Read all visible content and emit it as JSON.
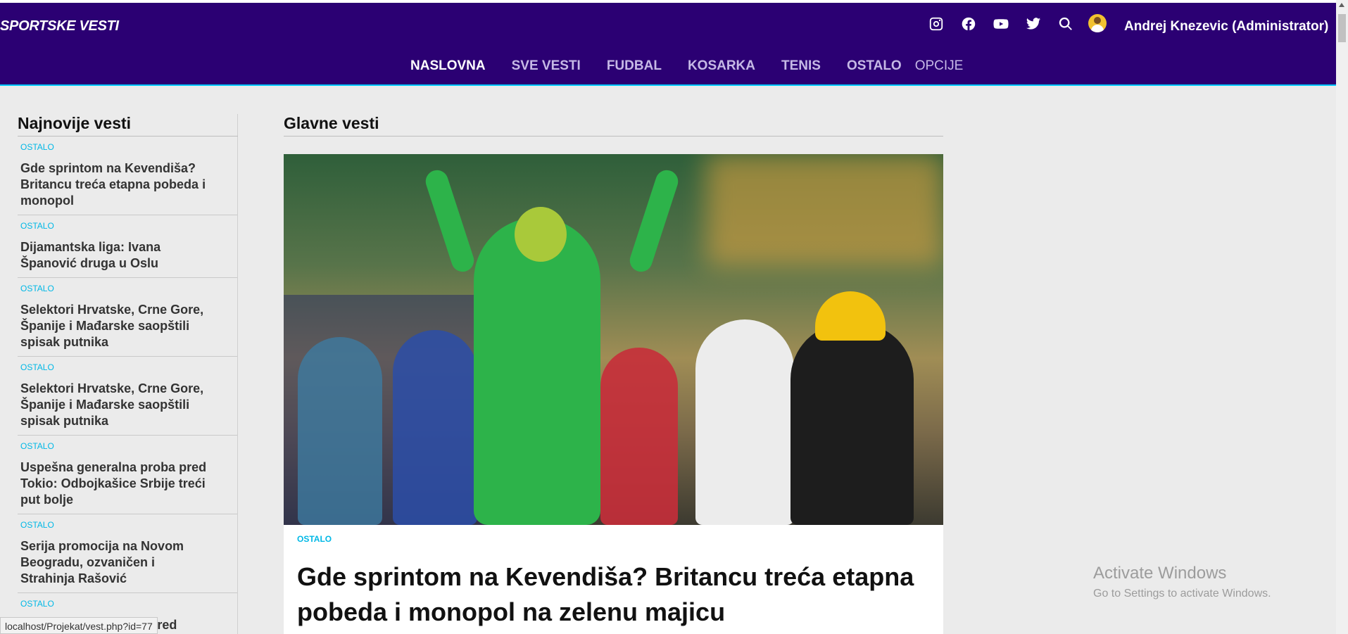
{
  "header": {
    "brand": "SPORTSKE VESTI",
    "social_icons": [
      "instagram-icon",
      "facebook-icon",
      "youtube-icon",
      "twitter-icon",
      "search-icon"
    ],
    "user_name": "Andrej Knezevic (Administrator)",
    "nav": [
      {
        "label": "NASLOVNA",
        "active": true
      },
      {
        "label": "SVE VESTI",
        "active": false
      },
      {
        "label": "FUDBAL",
        "active": false
      },
      {
        "label": "KOSARKA",
        "active": false
      },
      {
        "label": "TENIS",
        "active": false
      },
      {
        "label": "OSTALO",
        "active": false
      },
      {
        "label": "OPCIJE",
        "active": false
      }
    ]
  },
  "sidebar": {
    "title": "Najnovije vesti",
    "items": [
      {
        "category": "OSTALO",
        "title": "Gde sprintom na Kevendiša? Britancu treća etapna pobeda i monopol"
      },
      {
        "category": "OSTALO",
        "title": "Dijamantska liga: Ivana Španović druga u Oslu"
      },
      {
        "category": "OSTALO",
        "title": "Selektori Hrvatske, Crne Gore, Španije i Mađarske saopštili spisak putnika"
      },
      {
        "category": "OSTALO",
        "title": "Selektori Hrvatske, Crne Gore, Španije i Mađarske saopštili spisak putnika"
      },
      {
        "category": "OSTALO",
        "title": "Uspešna generalna proba pred Tokio: Odbojkašice Srbije treći put bolje"
      },
      {
        "category": "OSTALO",
        "title": "Serija promocija na Novom Beogradu, ozvaničen i Strahinja Rašović"
      },
      {
        "category": "OSTALO",
        "title": "Tenisi Srbije u Tokiju pred"
      }
    ]
  },
  "main": {
    "title": "Glavne vesti",
    "featured": {
      "category": "OSTALO",
      "headline": "Gde sprintom na Kevendiša? Britancu treća etapna pobeda i monopol na zelenu majicu"
    }
  },
  "watermark": {
    "line1": "Activate Windows",
    "line2": "Go to Settings to activate Windows."
  },
  "statusbar": {
    "url": "localhost/Projekat/vest.php?id=77"
  },
  "colors": {
    "navbar": "#2b0073",
    "accent": "#00b8e6",
    "background": "#ebebeb"
  }
}
